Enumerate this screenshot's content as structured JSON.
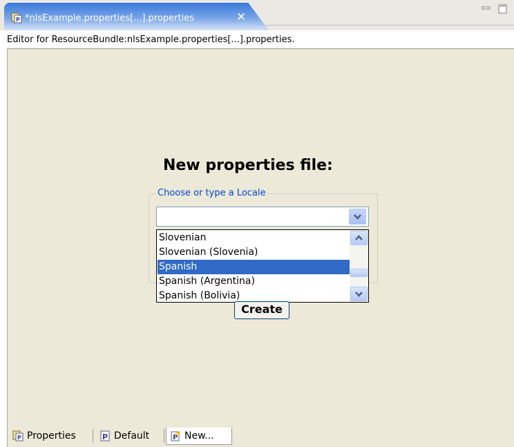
{
  "editor_tab": {
    "title": "*nlsExample.properties[...].properties",
    "icon": "properties-file-icon",
    "close_icon": "close-icon"
  },
  "window_controls": {
    "minimize_icon": "minimize-icon",
    "maximize_icon": "maximize-icon"
  },
  "description": "Editor for ResourceBundle:nlsExample.properties[...].properties.",
  "form": {
    "heading": "New properties file:",
    "group_label": "Choose or type a Locale",
    "locale_value": "",
    "options": [
      "Slovenian",
      "Slovenian (Slovenia)",
      "Spanish",
      "Spanish (Argentina)",
      "Spanish (Bolivia)"
    ],
    "selected_option": "Spanish",
    "create_label": "Create"
  },
  "bottom_tabs": [
    {
      "label": "Properties",
      "icon": "properties-icon"
    },
    {
      "label": "Default",
      "icon": "properties-file-icon"
    },
    {
      "label": "New...",
      "icon": "new-properties-file-icon"
    }
  ],
  "colors": {
    "selection": "#316ac5",
    "group_label": "#0046d5",
    "tab_active": "#3978da",
    "background": "#ece9d8"
  }
}
